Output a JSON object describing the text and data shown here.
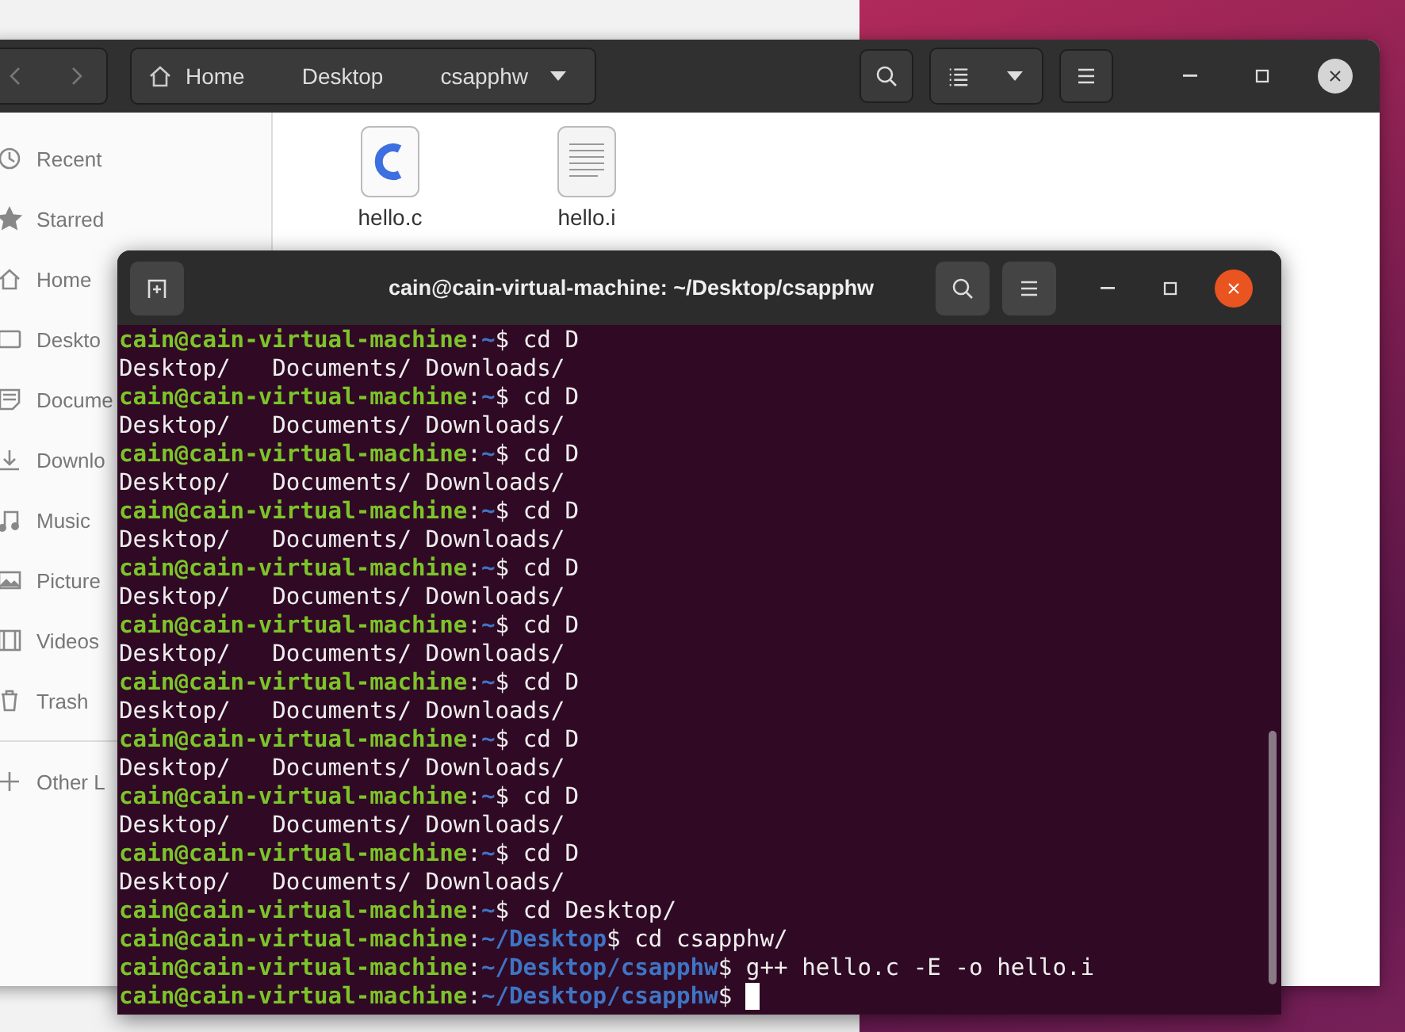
{
  "files_window": {
    "path_bar": [
      {
        "label": "Home",
        "kind": "home"
      },
      {
        "label": "Desktop",
        "kind": "folder"
      },
      {
        "label": "csapphw",
        "kind": "current"
      }
    ],
    "sidebar": {
      "items": [
        {
          "label": "Recent",
          "kind": "recent"
        },
        {
          "label": "Starred",
          "kind": "starred"
        },
        {
          "label": "Home",
          "kind": "home"
        },
        {
          "label": "Deskto",
          "kind": "desktop"
        },
        {
          "label": "Docume",
          "kind": "documents"
        },
        {
          "label": "Downlo",
          "kind": "downloads"
        },
        {
          "label": "Music",
          "kind": "music"
        },
        {
          "label": "Picture",
          "kind": "pictures"
        },
        {
          "label": "Videos",
          "kind": "videos"
        },
        {
          "label": "Trash",
          "kind": "trash"
        },
        {
          "label": "Other L",
          "kind": "other"
        }
      ]
    },
    "files": [
      {
        "name": "hello.c",
        "kind": "c"
      },
      {
        "name": "hello.i",
        "kind": "text"
      }
    ]
  },
  "terminal": {
    "title": "cain@cain-virtual-machine: ~/Desktop/csapphw",
    "lines": [
      {
        "kind": "prompt",
        "user": "cain@cain-virtual-machine",
        "sep": ":",
        "path": "~",
        "sign": "$",
        "command": "cd D"
      },
      {
        "kind": "output",
        "text": "Desktop/   Documents/ Downloads/"
      },
      {
        "kind": "prompt",
        "user": "cain@cain-virtual-machine",
        "sep": ":",
        "path": "~",
        "sign": "$",
        "command": "cd D"
      },
      {
        "kind": "output",
        "text": "Desktop/   Documents/ Downloads/"
      },
      {
        "kind": "prompt",
        "user": "cain@cain-virtual-machine",
        "sep": ":",
        "path": "~",
        "sign": "$",
        "command": "cd D"
      },
      {
        "kind": "output",
        "text": "Desktop/   Documents/ Downloads/"
      },
      {
        "kind": "prompt",
        "user": "cain@cain-virtual-machine",
        "sep": ":",
        "path": "~",
        "sign": "$",
        "command": "cd D"
      },
      {
        "kind": "output",
        "text": "Desktop/   Documents/ Downloads/"
      },
      {
        "kind": "prompt",
        "user": "cain@cain-virtual-machine",
        "sep": ":",
        "path": "~",
        "sign": "$",
        "command": "cd D"
      },
      {
        "kind": "output",
        "text": "Desktop/   Documents/ Downloads/"
      },
      {
        "kind": "prompt",
        "user": "cain@cain-virtual-machine",
        "sep": ":",
        "path": "~",
        "sign": "$",
        "command": "cd D"
      },
      {
        "kind": "output",
        "text": "Desktop/   Documents/ Downloads/"
      },
      {
        "kind": "prompt",
        "user": "cain@cain-virtual-machine",
        "sep": ":",
        "path": "~",
        "sign": "$",
        "command": "cd D"
      },
      {
        "kind": "output",
        "text": "Desktop/   Documents/ Downloads/"
      },
      {
        "kind": "prompt",
        "user": "cain@cain-virtual-machine",
        "sep": ":",
        "path": "~",
        "sign": "$",
        "command": "cd D"
      },
      {
        "kind": "output",
        "text": "Desktop/   Documents/ Downloads/"
      },
      {
        "kind": "prompt",
        "user": "cain@cain-virtual-machine",
        "sep": ":",
        "path": "~",
        "sign": "$",
        "command": "cd D"
      },
      {
        "kind": "output",
        "text": "Desktop/   Documents/ Downloads/"
      },
      {
        "kind": "prompt",
        "user": "cain@cain-virtual-machine",
        "sep": ":",
        "path": "~",
        "sign": "$",
        "command": "cd D"
      },
      {
        "kind": "output",
        "text": "Desktop/   Documents/ Downloads/"
      },
      {
        "kind": "prompt",
        "user": "cain@cain-virtual-machine",
        "sep": ":",
        "path": "~",
        "sign": "$",
        "command": "cd Desktop/"
      },
      {
        "kind": "prompt",
        "user": "cain@cain-virtual-machine",
        "sep": ":",
        "path": "~/Desktop",
        "sign": "$",
        "command": "cd csapphw/"
      },
      {
        "kind": "prompt",
        "user": "cain@cain-virtual-machine",
        "sep": ":",
        "path": "~/Desktop/csapphw",
        "sign": "$",
        "command": "g++ hello.c -E -o hello.i"
      },
      {
        "kind": "prompt",
        "user": "cain@cain-virtual-machine",
        "sep": ":",
        "path": "~/Desktop/csapphw",
        "sign": "$",
        "cursor": true
      }
    ]
  }
}
